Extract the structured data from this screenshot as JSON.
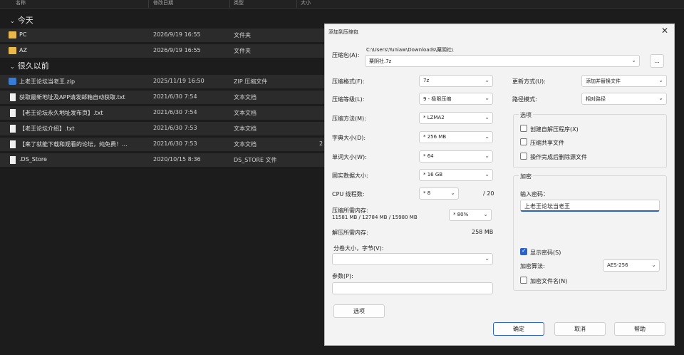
{
  "explorer": {
    "columns": [
      "名称",
      "修改日期",
      "类型",
      "大小"
    ],
    "groups": [
      {
        "label": "今天"
      },
      {
        "label": "很久以前"
      }
    ],
    "rows": [
      {
        "name": "PC",
        "date": "2026/9/19 16:55",
        "type": "文件夹",
        "size": "",
        "icon": "folder-icon"
      },
      {
        "name": "AZ",
        "date": "2026/9/19 16:55",
        "type": "文件夹",
        "size": "",
        "icon": "folder-icon"
      },
      {
        "name": "上老王论坛当老王.zip",
        "date": "2025/11/19 16:50",
        "type": "ZIP 压缩文件",
        "size": "",
        "icon": "zip-icon"
      },
      {
        "name": "获取最新地址及APP请发邮箱自动获取.txt",
        "date": "2021/6/30 7:54",
        "type": "文本文档",
        "size": "",
        "icon": "text-file-icon"
      },
      {
        "name": "【老王论坛永久地址发布页】.txt",
        "date": "2021/6/30 7:54",
        "type": "文本文档",
        "size": "",
        "icon": "text-file-icon"
      },
      {
        "name": "【老王论坛介绍】.txt",
        "date": "2021/6/30 7:53",
        "type": "文本文档",
        "size": "",
        "icon": "text-file-icon"
      },
      {
        "name": "【来了就能下载和观看的论坛，纯免费！...",
        "date": "2021/6/30 7:53",
        "type": "文本文档",
        "size": "2",
        "icon": "text-file-icon"
      },
      {
        "name": ".DS_Store",
        "date": "2020/10/15 8:36",
        "type": "DS_STORE 文件",
        "size": "",
        "icon": "text-file-icon"
      }
    ]
  },
  "dialog": {
    "title": "添加到压缩包",
    "archive_label": "压缩包(A):",
    "archive_path": "C:\\Users\\Yuniaw\\Downloads\\粟阴社\\",
    "archive_name": "粟阴社.7z",
    "browse_label": "...",
    "format_label": "压缩格式(F):",
    "format_value": "7z",
    "level_label": "压缩等级(L):",
    "level_value": "9 - 极限压缩",
    "method_label": "压缩方法(M):",
    "method_value": "* LZMA2",
    "dict_label": "字典大小(D):",
    "dict_value": "* 256 MB",
    "word_label": "单词大小(W):",
    "word_value": "* 64",
    "solid_label": "固实数据大小:",
    "solid_value": "* 16 GB",
    "cpu_label": "CPU 线程数:",
    "cpu_value": "* 8",
    "cpu_max": "/ 20",
    "mem_label": "压缩所需内存:",
    "mem_detail": "11581 MB / 12784 MB / 15980 MB",
    "mem_percent": "* 80%",
    "decomp_label": "解压所需内存:",
    "decomp_value": "258 MB",
    "split_label": "分卷大小，字节(V):",
    "split_value": "",
    "params_label": "参数(P):",
    "options_button": "选项",
    "update_label": "更新方式(U):",
    "update_value": "添加并替换文件",
    "path_label": "路径模式:",
    "path_value": "相对路径",
    "options_group": "选项",
    "opt_sfx": "创建自解压程序(X)",
    "opt_shared": "压缩共享文件",
    "opt_delete": "操作完成后删除源文件",
    "enc_group": "加密",
    "enc_pw_label": "输入密码：",
    "enc_pw_value": "上老王论坛当老王",
    "show_pw": "显示密码(S)",
    "enc_method_label": "加密算法:",
    "enc_method_value": "AES-256",
    "enc_names": "加密文件名(N)",
    "ok": "确定",
    "cancel": "取消",
    "help": "帮助",
    "close_icon": "close-icon"
  }
}
